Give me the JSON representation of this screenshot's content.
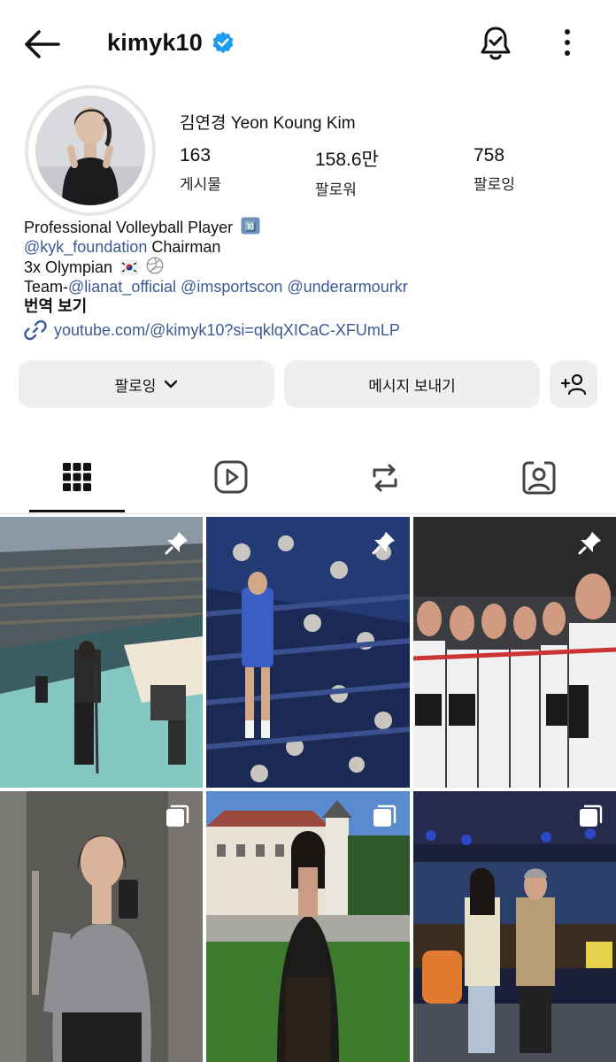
{
  "header": {
    "username": "kimyk10",
    "verified_icon": "verified-badge-icon",
    "accent_color": "#0095f6"
  },
  "profile": {
    "full_name": "김연경 Yeon Koung Kim",
    "stats": [
      {
        "value": "163",
        "label": "게시물"
      },
      {
        "value": "158.6만",
        "label": "팔로워"
      },
      {
        "value": "758",
        "label": "팔로잉"
      }
    ]
  },
  "bio": {
    "line1": "Professional Volleyball Player",
    "line1_emoji": "🔟",
    "line2_mention": "@kyk_foundation",
    "line2_text": " Chairman",
    "line3": "3x Olympian",
    "line4_prefix": "Team-",
    "line4_mentions": [
      "@lianat_official",
      "@imsportscon",
      "@underarmourkr"
    ],
    "translate": "번역 보기",
    "link": "youtube.com/@kimyk10?si=qklqXICaC-XFUmLP"
  },
  "actions": {
    "following_label": "팔로잉",
    "message_label": "메시지 보내기"
  },
  "tabs": [
    "grid-icon",
    "reels-icon",
    "reposts-icon",
    "tagged-icon"
  ],
  "posts": [
    {
      "name": "post-beach-volleyball-venue",
      "badge": "pin-icon"
    },
    {
      "name": "post-fans-stands",
      "badge": "pin-icon"
    },
    {
      "name": "post-team-lineup",
      "badge": "pin-icon"
    },
    {
      "name": "post-elevator-selfie",
      "badge": "carousel-icon"
    },
    {
      "name": "post-chateau-garden",
      "badge": "carousel-icon"
    },
    {
      "name": "post-tv-studio",
      "badge": "carousel-icon"
    }
  ]
}
